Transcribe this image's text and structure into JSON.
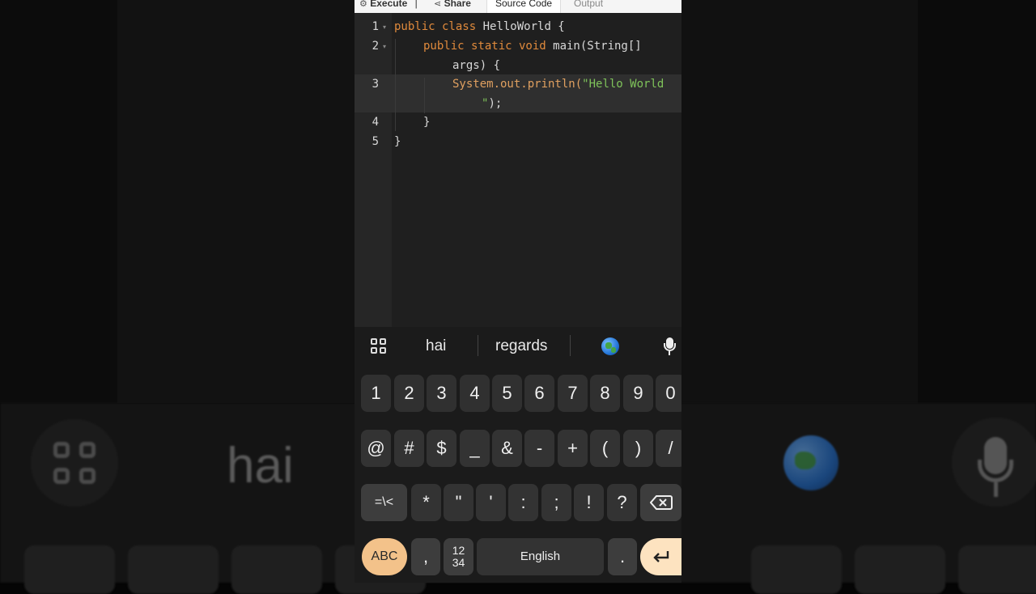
{
  "tabs": {
    "execute": "Execute",
    "share": "Share",
    "source_code": "Source Code",
    "output": "Output"
  },
  "editor": {
    "line_numbers": [
      "1",
      "2",
      "3",
      "4",
      "5"
    ],
    "lines": {
      "l1_kw": "public class",
      "l1_rest": " HelloWorld {",
      "l2_kw": "public static void",
      "l2_rest": " main(String[]",
      "l2b": "args) {",
      "l3_a": "System.out.println(",
      "l3_str": "\"Hello World",
      "l3b_str": "\"",
      "l3b_rest": ");",
      "l4": "}",
      "l5": "}"
    }
  },
  "keyboard": {
    "suggestions": [
      "hai",
      "regards"
    ],
    "row1": [
      "1",
      "2",
      "3",
      "4",
      "5",
      "6",
      "7",
      "8",
      "9",
      "0"
    ],
    "row2": [
      "@",
      "#",
      "$",
      "_",
      "&",
      "-",
      "+",
      "(",
      ")",
      "/"
    ],
    "row3": [
      "=\\<",
      "*",
      "\"",
      "'",
      ":",
      ";",
      "!",
      "?"
    ],
    "abc": "ABC",
    "comma": ",",
    "numpad": "12\n34",
    "space": "English",
    "period": "."
  },
  "background": {
    "hai": "hai"
  },
  "colors": {
    "keyword": "#e08a3c",
    "string": "#7fc35a",
    "accent_key": "#f3c28a"
  }
}
